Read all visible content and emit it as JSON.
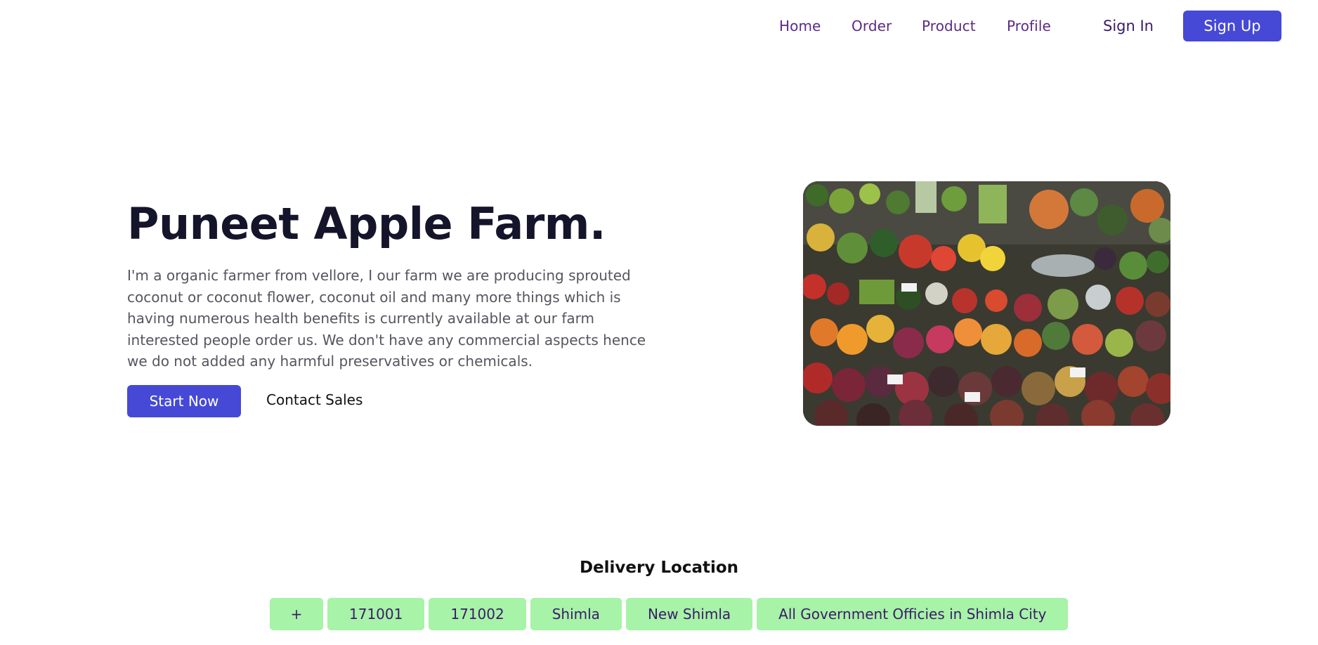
{
  "nav": {
    "links": [
      "Home",
      "Order",
      "Product",
      "Profile"
    ],
    "sign_in": "Sign In",
    "sign_up": "Sign Up"
  },
  "hero": {
    "title": "Puneet Apple Farm.",
    "description": "I'm a organic farmer from vellore, I our farm we are producing sprouted coconut or coconut flower, coconut oil and many more things which is having numerous health benefits is currently available at our farm interested people order us. We don't have any commercial aspects hence we do not added any harmful preservatives or chemicals.",
    "start_button": "Start Now",
    "contact_button": "Contact Sales"
  },
  "delivery": {
    "title": "Delivery Location",
    "add_label": "+",
    "locations": [
      "171001",
      "171002",
      "Shimla",
      "New Shimla",
      "All Government Officies in Shimla City"
    ]
  },
  "colors": {
    "accent": "#4549d6",
    "nav_text": "#5b2a86",
    "chip_bg": "#a7f3a7"
  }
}
